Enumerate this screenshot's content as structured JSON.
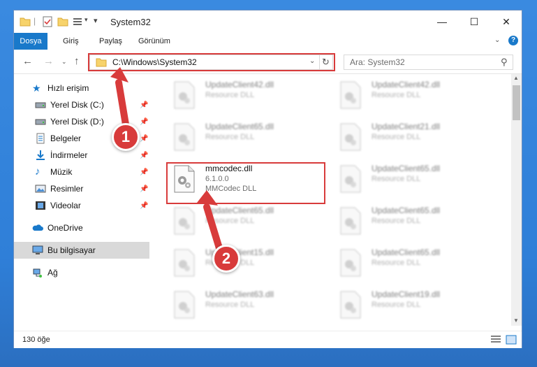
{
  "window": {
    "title": "System32",
    "minimize": "—",
    "maximize": "☐",
    "close": "✕"
  },
  "ribbon": {
    "tabs": [
      "Dosya",
      "Giriş",
      "Paylaş",
      "Görünüm"
    ],
    "active_tab": "Dosya"
  },
  "address": {
    "path": "C:\\Windows\\System32",
    "search_placeholder": "Ara: System32"
  },
  "nav": {
    "items": [
      {
        "label": "Hızlı erişim",
        "icon": "star-icon",
        "pinned": false
      },
      {
        "label": "Yerel Disk (C:)",
        "icon": "drive-icon",
        "pinned": true
      },
      {
        "label": "Yerel Disk (D:)",
        "icon": "drive-icon",
        "pinned": true
      },
      {
        "label": "Belgeler",
        "icon": "documents-icon",
        "pinned": true
      },
      {
        "label": "İndirmeler",
        "icon": "download-icon",
        "pinned": true
      },
      {
        "label": "Müzik",
        "icon": "music-icon",
        "pinned": true
      },
      {
        "label": "Resimler",
        "icon": "pictures-icon",
        "pinned": true
      },
      {
        "label": "Videolar",
        "icon": "videos-icon",
        "pinned": true
      },
      {
        "label": "OneDrive",
        "icon": "cloud-icon",
        "pinned": false
      },
      {
        "label": "Bu bilgisayar",
        "icon": "computer-icon",
        "pinned": false
      },
      {
        "label": "Ağ",
        "icon": "network-icon",
        "pinned": false
      }
    ],
    "selected": "Bu bilgisayar"
  },
  "files": [
    {
      "name": "UpdateClient42.dll",
      "type": "Resource DLL"
    },
    {
      "name": "UpdateClient42.dll",
      "type": "Resource DLL"
    },
    {
      "name": "UpdateClient65.dll",
      "type": "Resource DLL"
    },
    {
      "name": "UpdateClient21.dll",
      "type": "Resource DLL"
    },
    {
      "name": "mmcodec.dll",
      "version": "6.1.0.0",
      "type": "MMCodec DLL",
      "highlighted": true
    },
    {
      "name": "UpdateClient65.dll",
      "type": "Resource DLL"
    },
    {
      "name": "UpdateClient65.dll",
      "type": "Resource DLL"
    },
    {
      "name": "UpdateClient65.dll",
      "type": "Resource DLL"
    },
    {
      "name": "UpdateClient15.dll",
      "type": "Resource DLL"
    },
    {
      "name": "UpdateClient65.dll",
      "type": "Resource DLL"
    },
    {
      "name": "UpdateClient63.dll",
      "type": "Resource DLL"
    },
    {
      "name": "UpdateClient19.dll",
      "type": "Resource DLL"
    }
  ],
  "status": {
    "count": "130 öğe"
  },
  "annotations": {
    "step1": "1",
    "step2": "2"
  },
  "colors": {
    "accent": "#1979ca",
    "highlight_red": "#d83b3b"
  }
}
